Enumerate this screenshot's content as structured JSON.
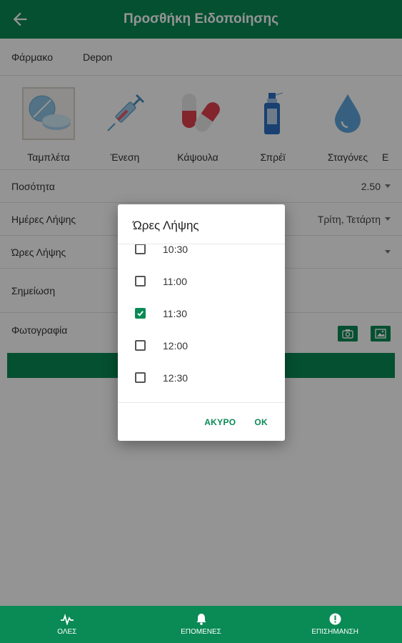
{
  "appbar": {
    "title": "Προσθήκη Ειδοποίησης",
    "back_icon": "arrow-back-icon"
  },
  "medicine": {
    "label": "Φάρμακο",
    "value": "Depon"
  },
  "forms": [
    {
      "label": "Ταμπλέτα",
      "icon": "tablet-icon",
      "selected": true
    },
    {
      "label": "Ένεση",
      "icon": "syringe-icon",
      "selected": false
    },
    {
      "label": "Κάψουλα",
      "icon": "capsule-icon",
      "selected": false
    },
    {
      "label": "Σπρέϊ",
      "icon": "spray-icon",
      "selected": false
    },
    {
      "label": "Σταγόνες",
      "icon": "drop-icon",
      "selected": false
    },
    {
      "label": "Ε",
      "icon": "",
      "selected": false
    }
  ],
  "fields": {
    "quantity": {
      "label": "Ποσότητα",
      "value": "2.50"
    },
    "days": {
      "label": "Ημέρες Λήψης",
      "value": "Τρίτη, Τετάρτη"
    },
    "hours": {
      "label": "Ώρες Λήψης",
      "value": ""
    },
    "note": {
      "label": "Σημείωση"
    },
    "photo": {
      "label": "Φωτογραφία"
    }
  },
  "dialog": {
    "title": "Ώρες Λήψης",
    "options": [
      {
        "time": "10:30",
        "checked": false
      },
      {
        "time": "11:00",
        "checked": false
      },
      {
        "time": "11:30",
        "checked": true
      },
      {
        "time": "12:00",
        "checked": false
      },
      {
        "time": "12:30",
        "checked": false
      }
    ],
    "cancel": "ΑΚΥΡΟ",
    "ok": "ΟΚ"
  },
  "bottom_nav": [
    {
      "label": "ΟΛΕΣ",
      "icon": "pulse-icon"
    },
    {
      "label": "ΕΠΟΜΕΝΕΣ",
      "icon": "bell-icon"
    },
    {
      "label": "ΕΠΙΣΗΜΑΝΣΗ",
      "icon": "alert-icon"
    }
  ],
  "colors": {
    "primary": "#0a8a55",
    "accent": "#0a8a55"
  }
}
